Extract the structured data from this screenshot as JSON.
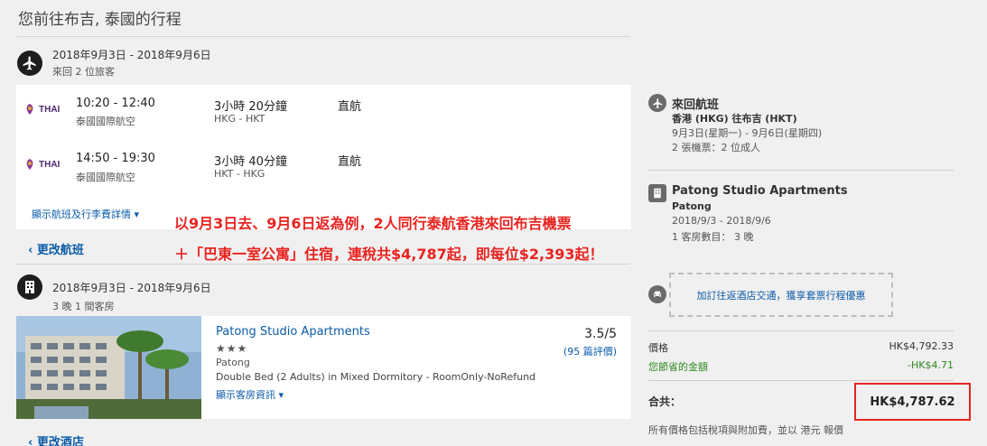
{
  "page_title": "您前往布吉, 泰國的行程",
  "flight_section": {
    "dates": "2018年9月3日 - 2018年9月6日",
    "sub": "來回   2 位旅客",
    "legs": [
      {
        "airline_logo": "THAI",
        "time": "10:20 - 12:40",
        "airline": "泰國國際航空",
        "duration": "3小時 20分鐘",
        "route": "HKG - HKT",
        "stops": "直航"
      },
      {
        "airline_logo": "THAI",
        "time": "14:50 - 19:30",
        "airline": "泰國國際航空",
        "duration": "3小時 40分鐘",
        "route": "HKT - HKG",
        "stops": "直航"
      }
    ],
    "details_link": "顯示航班及行李費詳情 ▾",
    "back_link": "‹ 更改航班"
  },
  "hotel_section": {
    "dates": "2018年9月3日 - 2018年9月6日",
    "sub": "3 晚   1 間客房",
    "name": "Patong Studio Apartments",
    "stars": "★★★",
    "location": "Patong",
    "room": "Double Bed (2 Adults) in Mixed Dormitory - RoomOnly-NoRefund",
    "details_link": "顯示客房資訊 ▾",
    "score": "3.5/5",
    "reviews": "(95 篇評價)",
    "back_link": "‹ 更改酒店"
  },
  "annotation": {
    "line1": "以9月3日去、9月6日返為例，2人同行泰航香港來回布吉機票",
    "line2": "＋「巴東一室公寓」住宿，連稅共$4,787起，即每位$2,393起！"
  },
  "summary": {
    "flight": {
      "title": "來回航班",
      "route": "香港 (HKG) 往布吉 (HKT)",
      "dates": "9月3日(星期一) - 9月6日(星期四)",
      "tickets": "2 張機票：2 位成人"
    },
    "hotel": {
      "title": "Patong Studio Apartments",
      "location": "Patong",
      "dates": "2018/9/3 - 2018/9/6",
      "rooms": "1 客房數目： 3 晚"
    },
    "promo": "加訂往返酒店交通，獲享套票行程優惠",
    "price_label": "價格",
    "price_value": "HK$4,792.33",
    "savings_label": "您節省的金額",
    "savings_value": "-HK$4.71",
    "total_label": "合共：",
    "total_value": "HK$4,787.62",
    "disclaimer": "所有價格包括稅項與附加費，並以 港元 報價"
  },
  "colors": {
    "accent": "#0b5ba8",
    "savings": "#2e8b1f",
    "highlight": "#e52520"
  }
}
